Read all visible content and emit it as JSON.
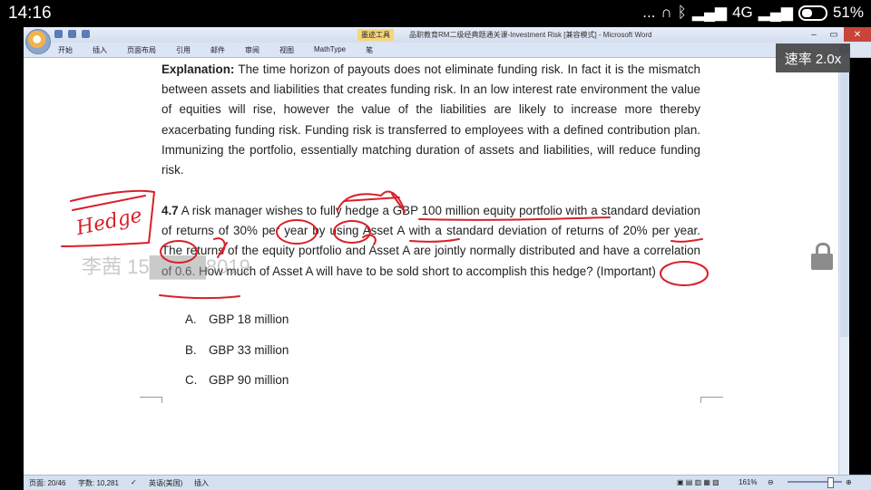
{
  "statusbar": {
    "time": "14:16",
    "indicators": "... ",
    "network": "4G",
    "battery": "51%"
  },
  "window": {
    "context_tab": "墨迹工具",
    "title": "品职教育RM二级经典题通关课-Investment Risk [兼容模式] - Microsoft Word",
    "ribbon_tabs": [
      "开始",
      "插入",
      "页面布局",
      "引用",
      "邮件",
      "审阅",
      "视图",
      "MathType",
      "笔"
    ]
  },
  "overlay": {
    "speed": "速率 2.0x",
    "watermark": "李茜 15████8019"
  },
  "document": {
    "explanation_label": "Explanation:",
    "explanation_text": " The time horizon of payouts does not eliminate funding risk. In fact it is the mismatch between assets and liabilities that creates funding risk. In an low interest rate environment the value of equities will rise, however the value of the liabilities are likely to increase more thereby exacerbating funding risk. Funding risk is transferred to employees with a defined contribution plan. Immunizing the portfolio, essentially matching duration of assets and liabilities, will reduce funding risk.",
    "question_number": "4.7",
    "question_text": "  A risk manager wishes to fully hedge a GBP 100 million equity portfolio with a standard deviation of returns of 30% per year by using Asset A with a standard deviation of returns of 20% per year. The returns of the equity portfolio and Asset A are jointly normally distributed and have a correlation of 0.6. How much of Asset A will have to be sold short to accomplish this hedge? (Important)",
    "options": [
      {
        "letter": "A.",
        "text": "GBP 18 million"
      },
      {
        "letter": "B.",
        "text": "GBP 33 million"
      },
      {
        "letter": "C.",
        "text": "GBP 90 million"
      }
    ]
  },
  "annotation": {
    "handwritten_word": "Hedge",
    "ink_color": "#d8202a"
  },
  "statusline": {
    "page": "页面: 20/46",
    "words": "字数: 10,281",
    "language": "英语(美国)",
    "mode": "插入",
    "zoom": "161%"
  }
}
